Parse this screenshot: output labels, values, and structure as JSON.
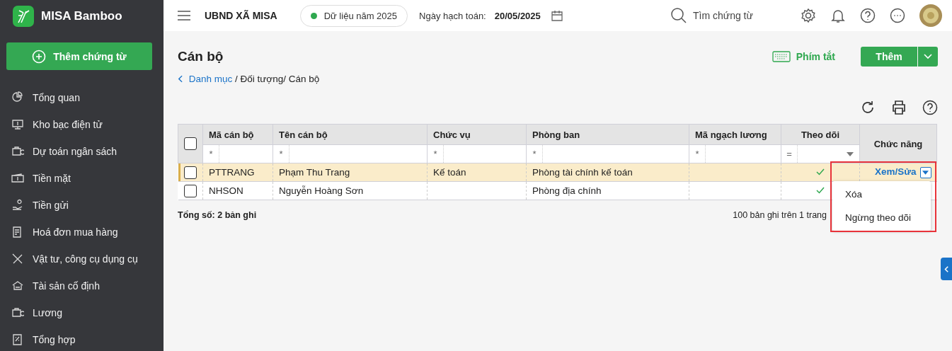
{
  "app": {
    "name": "MISA Bamboo"
  },
  "sidebar": {
    "add_button": "Thêm chứng từ",
    "items": [
      {
        "label": "Tổng quan",
        "selected": false
      },
      {
        "label": "Kho bạc điện tử",
        "selected": false
      },
      {
        "label": "Dự toán ngân sách",
        "selected": false
      },
      {
        "label": "Tiền mặt",
        "selected": false
      },
      {
        "label": "Tiền gửi",
        "selected": false
      },
      {
        "label": "Hoá đơn mua hàng",
        "selected": false
      },
      {
        "label": "Vật tư, công cụ dụng cụ",
        "selected": false
      },
      {
        "label": "Tài sản cố định",
        "selected": false
      },
      {
        "label": "Lương",
        "selected": false
      },
      {
        "label": "Tổng hợp",
        "selected": false
      }
    ]
  },
  "topbar": {
    "organization": "UBND XÃ MISA",
    "data_year": "Dữ liệu năm 2025",
    "posting_date_label": "Ngày hạch toán:",
    "posting_date": "20/05/2025",
    "search_placeholder": "Tìm chứng từ"
  },
  "page": {
    "title": "Cán bộ",
    "breadcrumb_link": "Danh mục",
    "breadcrumb_rest": " / Đối tượng/ Cán bộ",
    "shortcuts": "Phím tắt",
    "add_button": "Thêm"
  },
  "table": {
    "select_all_checked": false,
    "columns": [
      {
        "label": "Mã cán bộ",
        "filter": "*"
      },
      {
        "label": "Tên cán bộ",
        "filter": "*"
      },
      {
        "label": "Chức vụ",
        "filter": "*"
      },
      {
        "label": "Phòng ban",
        "filter": "*"
      },
      {
        "label": "Mã ngạch lương",
        "filter": "*"
      },
      {
        "label": "Theo dõi",
        "filter": "="
      },
      {
        "label": "Chức năng"
      }
    ],
    "rows": [
      {
        "code": "PTTRANG",
        "name": "Phạm Thu Trang",
        "position": "Kế toán",
        "department": "Phòng tài chính kế toán",
        "following": true,
        "checked": false,
        "selected": true,
        "action": "Xem/Sửa"
      },
      {
        "code": "NHSON",
        "name": "Nguyễn Hoàng Sơn",
        "department": "Phòng địa chính",
        "following": true,
        "checked": false,
        "selected": false
      }
    ],
    "total": "Tổng số: 2 bản ghi",
    "page_size": "100 bản ghi trên 1 trang"
  },
  "action_menu": {
    "items": [
      "Xóa",
      "Ngừng theo dõi"
    ]
  }
}
